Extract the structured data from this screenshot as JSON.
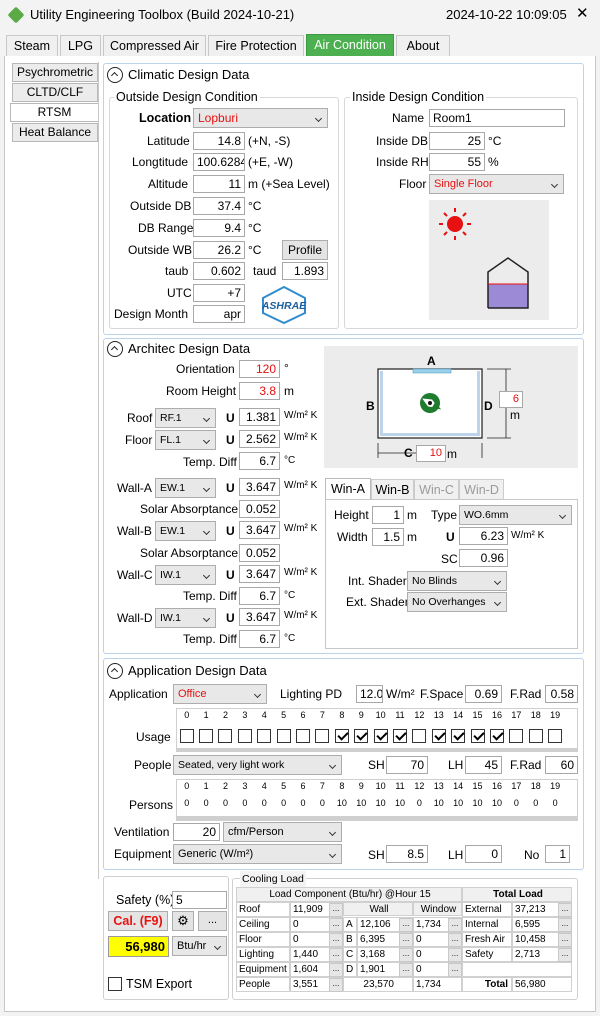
{
  "title": "Utility Engineering Toolbox (Build 2024-10-21)",
  "datetime": "2024-10-22 10:09:05",
  "close_glyph": "✕",
  "tabs": [
    "Steam",
    "LPG",
    "Compressed Air",
    "Fire Protection",
    "Air Condition",
    "About"
  ],
  "side_tabs": [
    "Psychrometric",
    "CLTD/CLF",
    "RTSM",
    "Heat Balance"
  ],
  "climatic": {
    "title": "Climatic Design Data",
    "outside_title": "Outside Design Condition",
    "inside_title": "Inside Design Condition",
    "location_label": "Location",
    "location": "Lopburi",
    "lat_label": "Latitude",
    "lat": "14.8",
    "lat_unit": "(+N, -S)",
    "lon_label": "Longtitude",
    "lon": "100.6284",
    "lon_unit": "(+E, -W)",
    "alt_label": "Altitude",
    "alt": "11",
    "alt_unit": "m (+Sea Level)",
    "odb_label": "Outside DB",
    "odb": "37.4",
    "odb_unit": "°C",
    "dbr_label": "DB Range",
    "dbr": "9.4",
    "dbr_unit": "°C",
    "owb_label": "Outside WB",
    "owb": "26.2",
    "owb_unit": "°C",
    "profile_btn": "Profile",
    "taub_label": "taub",
    "taub": "0.602",
    "taud_label": "taud",
    "taud": "1.893",
    "utc_label": "UTC",
    "utc": "+7",
    "month_label": "Design Month",
    "month": "apr",
    "ashrae": "ASHRAE",
    "name_label": "Name",
    "name": "Room1",
    "idb_label": "Inside DB",
    "idb": "25",
    "idb_unit": "°C",
    "irh_label": "Inside RH",
    "irh": "55",
    "irh_unit": "%",
    "floor_label": "Floor",
    "floor": "Single Floor"
  },
  "architec": {
    "title": "Architec Design Data",
    "orient_label": "Orientation",
    "orient": "120",
    "orient_unit": "°",
    "height_label": "Room Height",
    "height": "3.8",
    "height_unit": "m",
    "roof_label": "Roof",
    "roof": "RF.1",
    "roof_u": "1.381",
    "floor_label": "Floor",
    "floor": "FL.1",
    "floor_u": "2.562",
    "u_label": "U",
    "u_unit": "W/m² K",
    "tdiff_label": "Temp. Diff",
    "tdiff1": "6.7",
    "tdiff_unit": "°C",
    "wa_label": "Wall-A",
    "wa": "EW.1",
    "wa_u": "3.647",
    "sa_label": "Solar Absorptance",
    "sa1": "0.052",
    "wb_label": "Wall-B",
    "wb": "EW.1",
    "wb_u": "3.647",
    "sa2": "0.052",
    "wc_label": "Wall-C",
    "wc": "IW.1",
    "wc_u": "3.647",
    "tdiff2": "6.7",
    "wd_label": "Wall-D",
    "wd": "IW.1",
    "wd_u": "3.647",
    "tdiff3": "6.7",
    "diag": {
      "a": "A",
      "b": "B",
      "c": "C",
      "d": "D",
      "depth": "6",
      "depth_unit": "m",
      "width": "10",
      "width_unit": "m"
    },
    "win_tabs": [
      "Win-A",
      "Win-B",
      "Win-C",
      "Win-D"
    ],
    "win": {
      "h_label": "Height",
      "h": "1",
      "h_unit": "m",
      "type_label": "Type",
      "type": "WO.6mm",
      "w_label": "Width",
      "w": "1.5",
      "w_unit": "m",
      "u_label": "U",
      "u": "6.23",
      "u_unit": "W/m² K",
      "sc_label": "SC",
      "sc": "0.96",
      "ins_label": "Int. Shader",
      "ins": "No Blinds",
      "ext_label": "Ext. Shader",
      "ext": "No Overhanges"
    }
  },
  "application": {
    "title": "Application Design Data",
    "app_label": "Application",
    "app": "Office",
    "lpd_label": "Lighting PD",
    "lpd": "12.0",
    "lpd_unit": "W/m²",
    "fspace_label": "F.Space",
    "fspace": "0.69",
    "frad_label": "F.Rad",
    "frad1": "0.58",
    "hours": [
      "0",
      "1",
      "2",
      "3",
      "4",
      "5",
      "6",
      "7",
      "8",
      "9",
      "10",
      "11",
      "12",
      "13",
      "14",
      "15",
      "16",
      "17",
      "18",
      "19"
    ],
    "usage_label": "Usage",
    "usage": [
      false,
      false,
      false,
      false,
      false,
      false,
      false,
      false,
      true,
      true,
      true,
      true,
      false,
      true,
      true,
      true,
      true,
      false,
      false,
      false
    ],
    "people_label": "People",
    "people": "Seated, very light work",
    "sh_label": "SH",
    "sh1": "70",
    "lh_label": "LH",
    "lh1": "45",
    "frad2": "60",
    "persons_label": "Persons",
    "persons": [
      "0",
      "0",
      "0",
      "0",
      "0",
      "0",
      "0",
      "0",
      "10",
      "10",
      "10",
      "10",
      "0",
      "10",
      "10",
      "10",
      "10",
      "0",
      "0",
      "0"
    ],
    "vent_label": "Ventilation",
    "vent": "20",
    "vent_unit": "cfm/Person",
    "equip_label": "Equipment",
    "equip": "Generic (W/m²)",
    "sh2": "8.5",
    "lh2": "0",
    "no_label": "No",
    "no": "1"
  },
  "bottom": {
    "safety_label": "Safety (%)",
    "safety": "5",
    "calc_btn": "Cal. (F9)",
    "gear": "⚙",
    "more": "...",
    "result": "56,980",
    "unit": "Btu/hr",
    "tsm_label": "TSM Export"
  },
  "cooling": {
    "title": "Cooling Load",
    "header_left": "Load Component (Btu/hr) @Hour 15",
    "header_right": "Total Load",
    "col_wall": "Wall",
    "col_window": "Window",
    "rows": [
      {
        "n": "Roof",
        "v": "11,909"
      },
      {
        "n": "Ceiling",
        "v": "0"
      },
      {
        "n": "Floor",
        "v": "0"
      },
      {
        "n": "Lighting",
        "v": "1,440"
      },
      {
        "n": "Equipment",
        "v": "1,604"
      },
      {
        "n": "People",
        "v": "3,551"
      }
    ],
    "walls": [
      {
        "k": "A",
        "w": "12,106",
        "win": "1,734"
      },
      {
        "k": "B",
        "w": "6,395",
        "win": "0"
      },
      {
        "k": "C",
        "w": "3,168",
        "win": "0"
      },
      {
        "k": "D",
        "w": "1,901",
        "win": "0"
      }
    ],
    "wall_total": "23,570",
    "win_total": "1,734",
    "totals": [
      {
        "n": "External",
        "v": "37,213"
      },
      {
        "n": "Internal",
        "v": "6,595"
      },
      {
        "n": "Fresh Air",
        "v": "10,458"
      },
      {
        "n": "Safety",
        "v": "2,713"
      }
    ],
    "total_label": "Total",
    "total": "56,980"
  }
}
